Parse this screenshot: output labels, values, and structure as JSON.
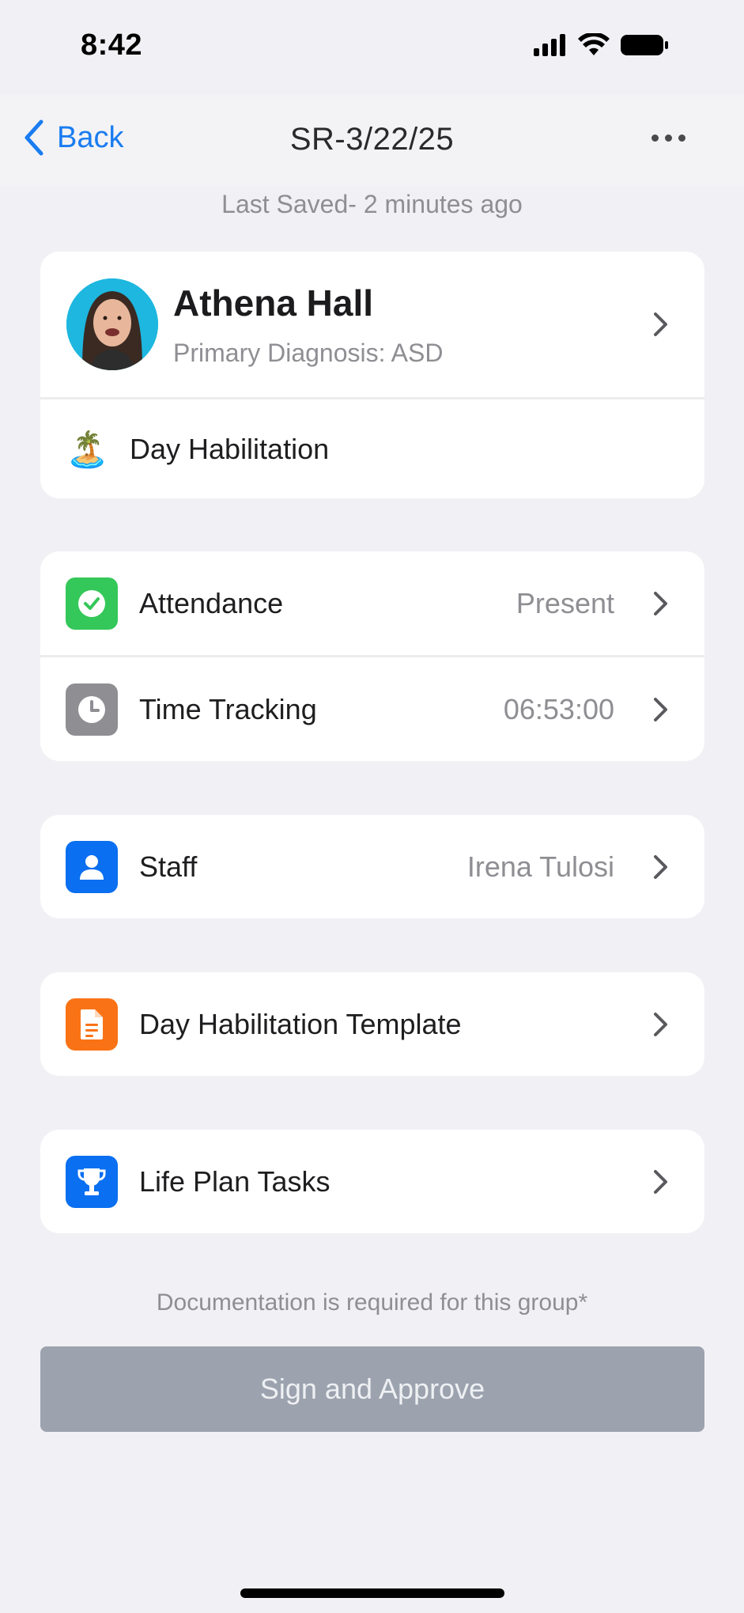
{
  "status_bar": {
    "time": "8:42"
  },
  "nav": {
    "back_label": "Back",
    "title": "SR-3/22/25"
  },
  "last_saved": "Last Saved- 2 minutes ago",
  "client": {
    "name": "Athena Hall",
    "diagnosis": "Primary Diagnosis: ASD",
    "program_label": "Day Habilitation",
    "program_icon": "🏝️"
  },
  "rows": {
    "attendance": {
      "label": "Attendance",
      "value": "Present",
      "icon": "check-icon",
      "color": "#34c759"
    },
    "time_tracking": {
      "label": "Time Tracking",
      "value": "06:53:00",
      "icon": "clock-icon",
      "color": "#8e8e93"
    },
    "staff": {
      "label": "Staff",
      "value": "Irena Tulosi",
      "icon": "person-icon",
      "color": "#0a6ff0"
    },
    "template": {
      "label": "Day Habilitation Template",
      "icon": "document-icon",
      "color": "#f97316"
    },
    "life_plan": {
      "label": "Life Plan Tasks",
      "icon": "trophy-icon",
      "color": "#0a6ff0"
    }
  },
  "footer": {
    "note": "Documentation is required for this group*",
    "sign_button": "Sign and Approve"
  }
}
